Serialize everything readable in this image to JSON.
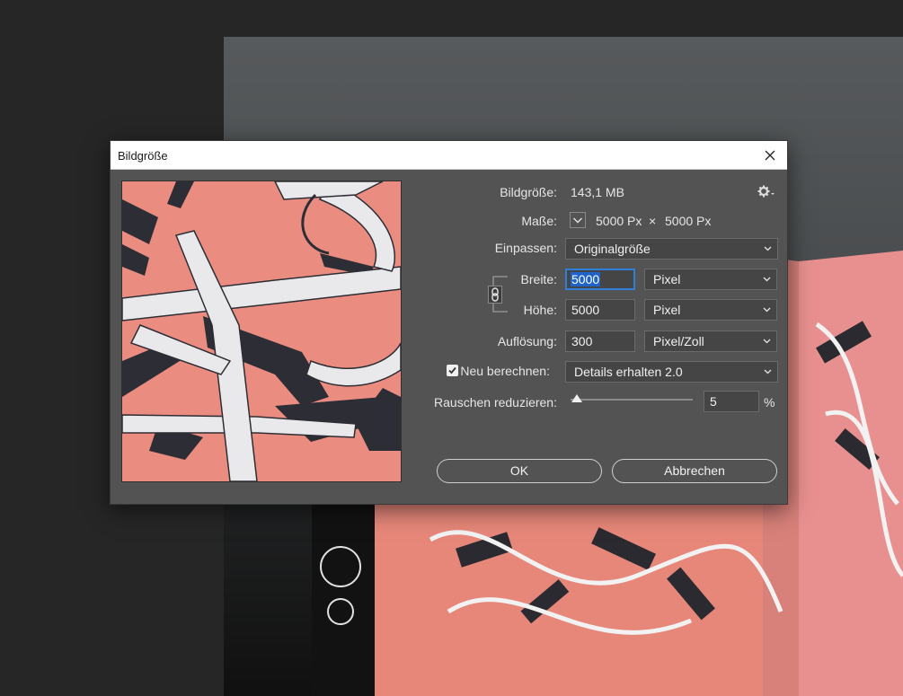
{
  "dialog": {
    "title": "Bildgröße",
    "image_size_label": "Bildgröße:",
    "image_size_value": "143,1 MB",
    "dimensions_label": "Maße:",
    "dimensions_width": "5000 Px",
    "dimensions_times": "×",
    "dimensions_height": "5000 Px",
    "fit_label": "Einpassen:",
    "fit_value": "Originalgröße",
    "width_label": "Breite:",
    "width_value": "5000",
    "width_unit": "Pixel",
    "height_label": "Höhe:",
    "height_value": "5000",
    "height_unit": "Pixel",
    "resolution_label": "Auflösung:",
    "resolution_value": "300",
    "resolution_unit": "Pixel/Zoll",
    "resample_label": "Neu berechnen:",
    "resample_checked": true,
    "resample_value": "Details erhalten 2.0",
    "noise_label": "Rauschen reduzieren:",
    "noise_value": "5",
    "noise_slider_fraction": 0.05,
    "noise_unit": "%",
    "ok_label": "OK",
    "cancel_label": "Abbrechen"
  },
  "icons": [
    "close-icon",
    "gear-icon",
    "chevron-down-icon",
    "chain-link-icon",
    "checkmark-icon"
  ],
  "colors": {
    "dialog_bg": "#535353",
    "titlebar_bg": "#ffffff",
    "field_bg": "#454545",
    "focus_blue": "#2f7ed8",
    "selection_blue": "#1f63c7",
    "artwork_salmon": "#ea8d80",
    "artwork_dark": "#2d2d35"
  }
}
